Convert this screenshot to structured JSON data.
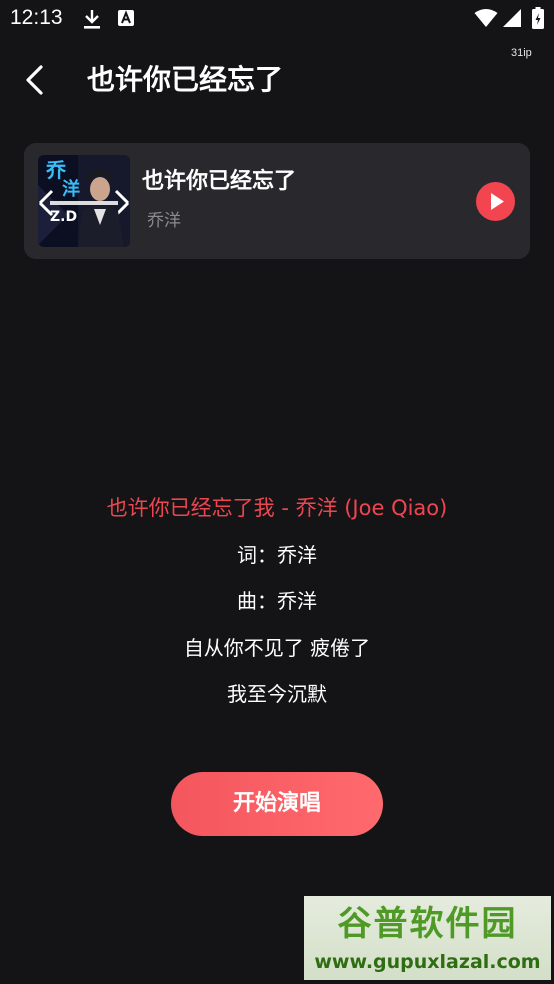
{
  "status_bar": {
    "time": "12:13",
    "data_speed": "31ip",
    "icons": [
      "download-icon",
      "a-notification-icon",
      "wifi-icon",
      "cellular-signal-icon",
      "battery-icon"
    ]
  },
  "header": {
    "back_icon": "chevron-left-icon",
    "title": "也许你已经忘了"
  },
  "song_card": {
    "title": "也许你已经忘了",
    "artist": "乔洋",
    "play_icon": "play-icon",
    "play_color": "#f2454f"
  },
  "lyrics": {
    "lines": [
      "也许你已经忘了我 - 乔洋 (Joe Qiao)",
      "词：乔洋",
      "曲：乔洋",
      "自从你不见了 疲倦了",
      "我至今沉默"
    ],
    "highlight_color": "#ee4650"
  },
  "actions": {
    "start_label": "开始演唱"
  },
  "watermark": {
    "title": "谷普软件园",
    "url": "www.gupuxlazal.com"
  },
  "colors": {
    "background": "#141416",
    "card": "#29292d",
    "accent": "#f4565d"
  }
}
